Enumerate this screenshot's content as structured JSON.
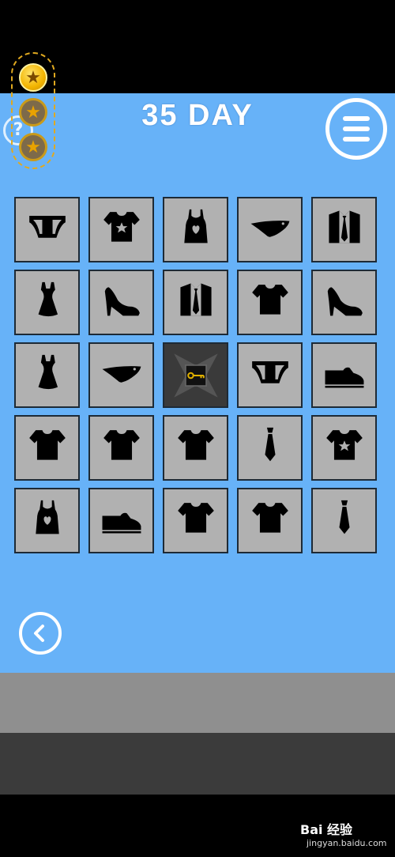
{
  "header": {
    "title": "35 DAY"
  },
  "stars": [
    {
      "state": "earned"
    },
    {
      "state": "empty"
    },
    {
      "state": "empty"
    }
  ],
  "hint": {
    "label": "?"
  },
  "grid": {
    "rows": [
      [
        "briefs",
        "star-tshirt",
        "heart-tank-top",
        "panties",
        "shirt-and-tie"
      ],
      [
        "dress",
        "high-heel",
        "shirt-and-tie",
        "tshirt",
        "high-heel"
      ],
      [
        "dress",
        "panties",
        "key-box",
        "briefs",
        "dress-shoe"
      ],
      [
        "tshirt",
        "tshirt",
        "tshirt",
        "necktie",
        "star-tshirt"
      ],
      [
        "heart-tank-top",
        "dress-shoe",
        "tshirt",
        "tshirt",
        "necktie"
      ]
    ]
  },
  "watermark": {
    "brand": "Bai 经验",
    "url": "jingyan.baidu.com"
  },
  "colors": {
    "background": "#67b2f8",
    "tile": "#b1b1b1",
    "star": "#f2b400"
  }
}
